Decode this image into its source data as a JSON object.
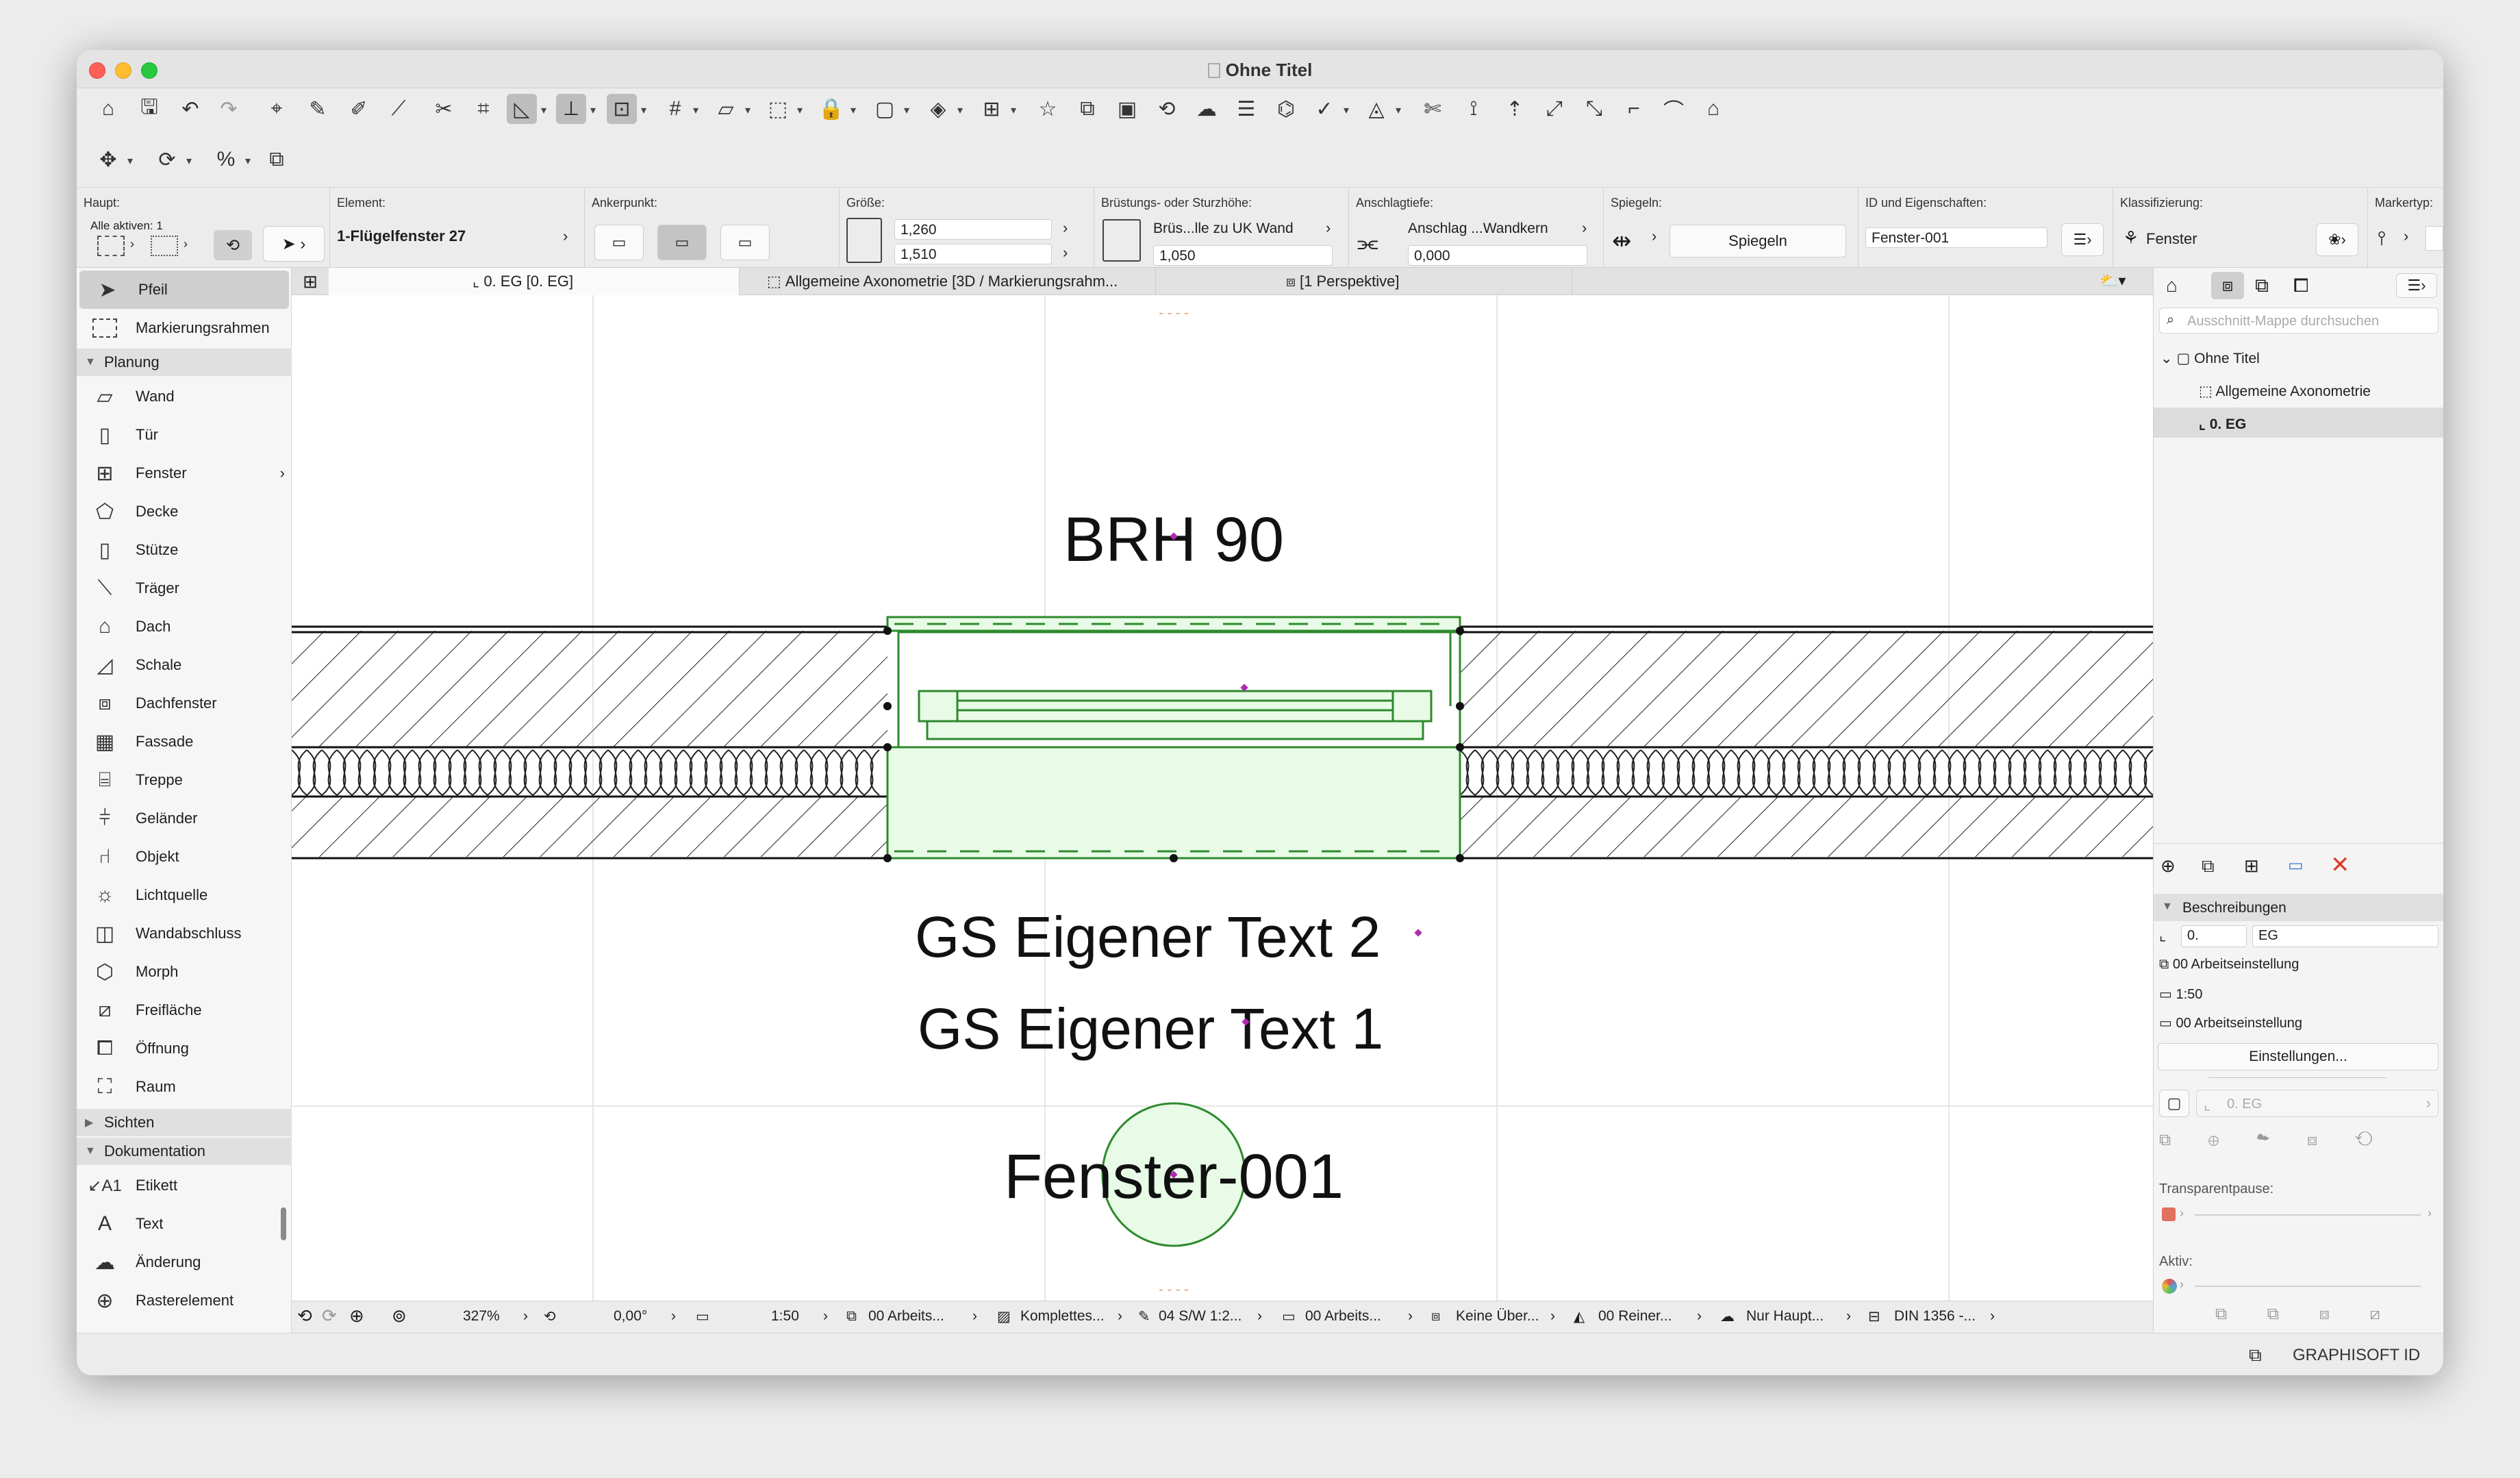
{
  "window": {
    "title": "Ohne Titel"
  },
  "info_box": {
    "haupt": {
      "label": "Haupt:",
      "alle_aktiven": "Alle aktiven: 1"
    },
    "element": {
      "label": "Element:",
      "value": "1-Flügelfenster 27"
    },
    "ankerpunkt": {
      "label": "Ankerpunkt:"
    },
    "groesse": {
      "label": "Größe:",
      "width": "1,260",
      "height": "1,510"
    },
    "bruestung": {
      "label": "Brüstungs- oder Sturzhöhe:",
      "ref": "Brüs...lle zu UK Wand",
      "value": "1,050"
    },
    "anschlag": {
      "label": "Anschlagtiefe:",
      "ref": "Anschlag ...Wandkern",
      "value": "0,000"
    },
    "spiegeln": {
      "label": "Spiegeln:",
      "button": "Spiegeln"
    },
    "id": {
      "label": "ID und Eigenschaften:",
      "value": "Fenster-001"
    },
    "klass": {
      "label": "Klassifizierung:",
      "value": "Fenster"
    },
    "markertyp": {
      "label": "Markertyp:"
    }
  },
  "toolbox": {
    "pfeil": "Pfeil",
    "markierungsrahmen": "Markierungsrahmen",
    "planung": "Planung",
    "wand": "Wand",
    "tuer": "Tür",
    "fenster": "Fenster",
    "decke": "Decke",
    "stuetze": "Stütze",
    "traeger": "Träger",
    "dach": "Dach",
    "schale": "Schale",
    "dachfenster": "Dachfenster",
    "fassade": "Fassade",
    "treppe": "Treppe",
    "gelaender": "Geländer",
    "objekt": "Objekt",
    "lichtquelle": "Lichtquelle",
    "wandabschluss": "Wandabschluss",
    "morph": "Morph",
    "freiflaeche": "Freifläche",
    "oeffnung": "Öffnung",
    "raum": "Raum",
    "sichten": "Sichten",
    "dokumentation": "Dokumentation",
    "etikett": "Etikett",
    "text": "Text",
    "aenderung": "Änderung",
    "rasterelement": "Rasterelement"
  },
  "tabs": {
    "t1": "0. EG [0. EG]",
    "t2": "Allgemeine Axonometrie [3D / Markierungsrahm...",
    "t3": "[1 Perspektive]"
  },
  "drawing": {
    "brh": "BRH 90",
    "text2": "GS Eigener Text 2",
    "text1": "GS Eigener Text 1",
    "id_label": "Fenster-001",
    "placeholder_marks": "- - - -"
  },
  "statusbar": {
    "zoom": "327%",
    "angle": "0,00°",
    "scale": "1:50",
    "layer": "00 Arbeits...",
    "structure": "Komplettes...",
    "pen": "04 S/W 1:2...",
    "mvo": "00 Arbeits...",
    "renovation": "Keine Über...",
    "graphic": "00 Reiner...",
    "partial": "Nur Haupt...",
    "dimension": "DIN 1356 -..."
  },
  "navigator": {
    "search_placeholder": "Ausschnitt-Mappe durchsuchen",
    "root": "Ohne Titel",
    "item1": "Allgemeine Axonometrie",
    "item2": "0. EG",
    "beschreibungen": "Beschreibungen",
    "field_num": "0.",
    "field_name": "EG",
    "layer": "00 Arbeitseinstellung",
    "scale": "1:50",
    "mvo": "00 Arbeitseinstellung",
    "einstellungen": "Einstellungen...",
    "storey_field": "0. EG",
    "transparent": "Transparentpause:",
    "aktiv": "Aktiv:"
  },
  "bottom": {
    "graphisoft": "GRAPHISOFT ID"
  },
  "colors": {
    "window_fill": "#e8fbe6",
    "window_stroke": "#2e8a2e",
    "selection_handle": "#b02ab0",
    "delete_red": "#e03b2b"
  }
}
